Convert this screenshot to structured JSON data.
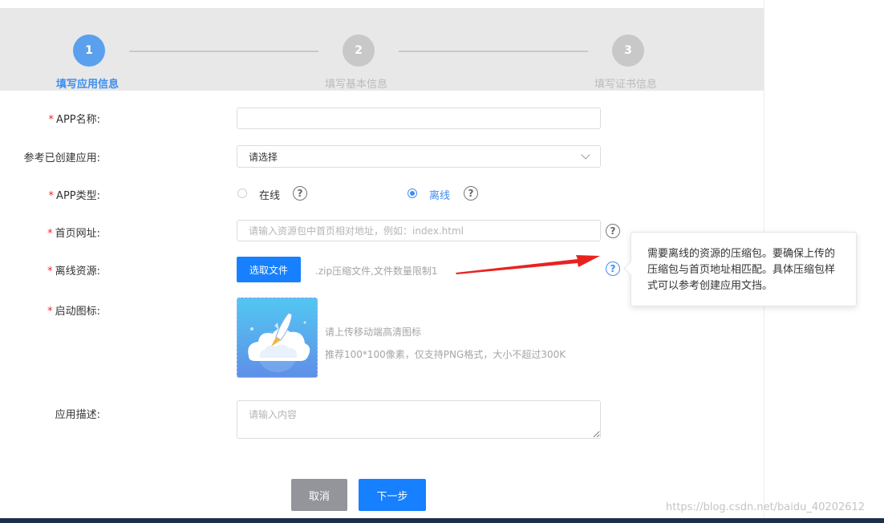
{
  "steps": [
    {
      "number": "1",
      "label": "填写应用信息",
      "active": true
    },
    {
      "number": "2",
      "label": "填写基本信息",
      "active": false
    },
    {
      "number": "3",
      "label": "填写证书信息",
      "active": false
    }
  ],
  "form": {
    "app_name": {
      "label": "APP名称:",
      "required": "*",
      "value": ""
    },
    "reference_app": {
      "label": "参考已创建应用:",
      "value": "请选择"
    },
    "app_type": {
      "label": "APP类型:",
      "required": "*",
      "options": [
        "在线",
        "离线"
      ],
      "selected": "离线"
    },
    "home_url": {
      "label": "首页网址:",
      "required": "*",
      "placeholder": "请输入资源包中首页相对地址，例如：index.html"
    },
    "offline_resource": {
      "label": "离线资源:",
      "required": "*",
      "button": "选取文件",
      "hint": ".zip压缩文件,文件数量限制1"
    },
    "launch_icon": {
      "label": "启动图标:",
      "required": "*",
      "hint1": "请上传移动端高清图标",
      "hint2": "推荐100*100像素，仅支持PNG格式，大小不超过300K"
    },
    "description": {
      "label": "应用描述:",
      "placeholder": "请输入内容"
    }
  },
  "tooltip": {
    "text": "需要离线的资源的压缩包。要确保上传的压缩包与首页地址相匹配。具体压缩包样式可以参考创建应用文挡。"
  },
  "help_symbol": "?",
  "buttons": {
    "cancel": "取消",
    "next": "下一步"
  },
  "watermark": "https://blog.csdn.net/baidu_40202612",
  "colors": {
    "primary": "#1680ff",
    "step_active": "#5aa0ee",
    "required": "#f5222d",
    "arrow": "#e8231f"
  }
}
